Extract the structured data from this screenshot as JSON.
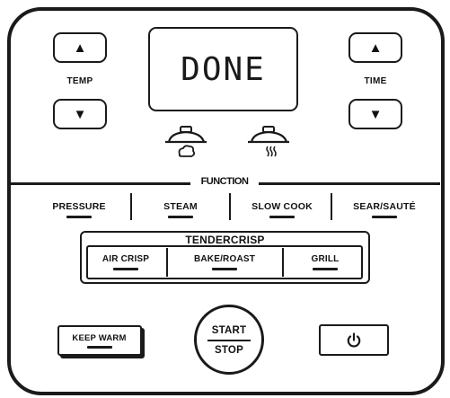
{
  "panel": {
    "display_text": "DONE",
    "temp": {
      "label": "TEMP",
      "up_glyph": "▲",
      "down_glyph": "▼"
    },
    "time": {
      "label": "TIME",
      "up_glyph": "▲",
      "down_glyph": "▼"
    },
    "indicators": [
      {
        "name": "pressure-lid-icon"
      },
      {
        "name": "steam-lid-icon"
      }
    ],
    "function": {
      "heading": "FUNCTION",
      "items": [
        {
          "label": "PRESSURE"
        },
        {
          "label": "STEAM"
        },
        {
          "label": "SLOW COOK"
        },
        {
          "label": "SEAR/SAUTÉ"
        }
      ]
    },
    "tendercrisp": {
      "heading": "TENDERCRISP",
      "items": [
        {
          "label": "AIR CRISP"
        },
        {
          "label": "BAKE/ROAST"
        },
        {
          "label": "GRILL"
        }
      ]
    },
    "keep_warm": {
      "label": "KEEP WARM"
    },
    "start_stop": {
      "top": "START",
      "bottom": "STOP"
    },
    "power": {
      "icon": "power-icon"
    }
  }
}
